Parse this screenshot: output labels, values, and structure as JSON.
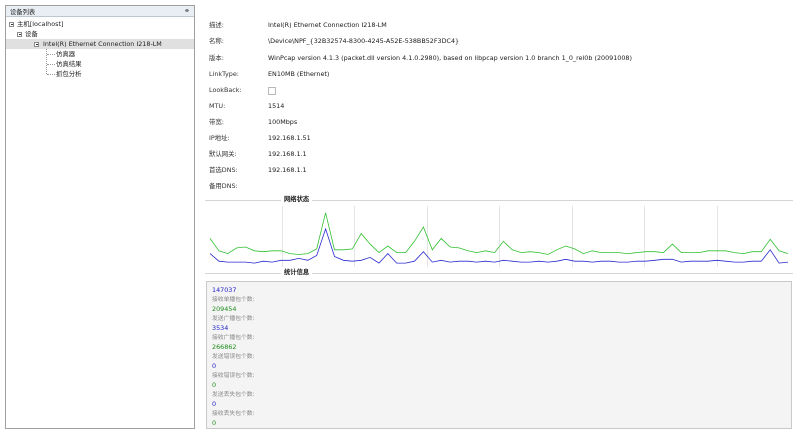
{
  "left_panel": {
    "title": "设备列表",
    "tree": {
      "host": "主机[localhost]",
      "devices": "设备",
      "adapter": "Intel(R) Ethernet Connection I218-LM",
      "children": [
        "仿真器",
        "仿真结果",
        "抓包分析"
      ]
    }
  },
  "info": [
    {
      "label": "描述:",
      "value": "Intel(R) Ethernet Connection I218-LM"
    },
    {
      "label": "名称:",
      "value": "\\Device\\NPF_{32B32574-8300-4245-A52E-538BB52F3DC4}"
    },
    {
      "label": "版本:",
      "value": "WinPcap version 4.1.3 (packet.dll version 4.1.0.2980), based on libpcap version 1.0 branch 1_0_rel0b (20091008)"
    },
    {
      "label": "LinkType:",
      "value": "EN10MB (Ethernet)"
    },
    {
      "label": "LookBack:",
      "value": ""
    },
    {
      "label": "MTU:",
      "value": "1514"
    },
    {
      "label": "带宽:",
      "value": "100Mbps"
    },
    {
      "label": "IP地址:",
      "value": "192.168.1.51"
    },
    {
      "label": "默认网关:",
      "value": "192.168.1.1"
    },
    {
      "label": "首选DNS:",
      "value": "192.168.1.1"
    },
    {
      "label": "备用DNS:",
      "value": ""
    }
  ],
  "network_section_title": "网络状态",
  "stats_section_title": "统计信息",
  "chart_data": {
    "type": "line",
    "series": [
      {
        "color": "#30c030",
        "values": [
          28,
          15,
          12,
          18,
          19,
          15,
          14,
          15,
          15,
          12,
          11,
          12,
          17,
          55,
          16,
          16,
          17,
          33,
          22,
          13,
          20,
          13,
          13,
          25,
          40,
          16,
          28,
          19,
          18,
          15,
          13,
          15,
          13,
          25,
          16,
          13,
          14,
          13,
          11,
          16,
          20,
          17,
          12,
          15,
          13,
          13,
          13,
          12,
          13,
          14,
          14,
          13,
          22,
          13,
          13,
          13,
          15,
          15,
          15,
          13,
          12,
          14,
          14,
          27,
          15,
          12
        ]
      },
      {
        "color": "#2a2ad0",
        "values": [
          12,
          4,
          3,
          3,
          3,
          2,
          4,
          3,
          5,
          5,
          7,
          5,
          10,
          38,
          9,
          5,
          4,
          5,
          8,
          2,
          12,
          2,
          2,
          4,
          14,
          3,
          5,
          3,
          4,
          4,
          3,
          4,
          3,
          5,
          4,
          3,
          3,
          4,
          3,
          4,
          6,
          4,
          4,
          3,
          4,
          4,
          3,
          3,
          4,
          4,
          5,
          6,
          6,
          3,
          4,
          4,
          4,
          5,
          4,
          3,
          3,
          4,
          4,
          16,
          2,
          3
        ]
      }
    ],
    "ylim": [
      0,
      60
    ],
    "grid": true
  },
  "stats": [
    {
      "value": "147037",
      "label": "接收单播包个数:",
      "color": "#2020c8"
    },
    {
      "value": "209454",
      "label": "发送广播包个数:",
      "color": "#1a8a1a"
    },
    {
      "value": "3534",
      "label": "接收广播包个数:",
      "color": "#2020c8"
    },
    {
      "value": "266862",
      "label": "发送错误包个数:",
      "color": "#1a8a1a"
    },
    {
      "value": "0",
      "label": "接收错误包个数:",
      "color": "#2020c8"
    },
    {
      "value": "0",
      "label": "发送丢失包个数:",
      "color": "#1a8a1a"
    },
    {
      "value": "0",
      "label": "接收丢失包个数:",
      "color": "#2020c8"
    },
    {
      "value": "0",
      "label": "",
      "color": "#1a8a1a"
    }
  ]
}
